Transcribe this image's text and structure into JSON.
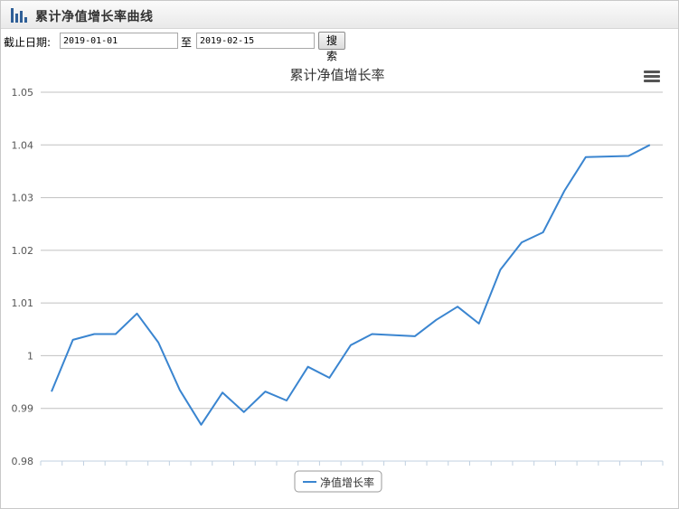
{
  "window": {
    "title": "累计净值增长率曲线"
  },
  "filter": {
    "label": "截止日期:",
    "start_date": "2019-01-01",
    "separator": "至",
    "end_date": "2019-02-15",
    "search_label": "搜索"
  },
  "chart_data": {
    "type": "line",
    "title": "累计净值增长率",
    "xlabel": "",
    "ylabel": "",
    "ylim": [
      0.98,
      1.05
    ],
    "yticks": [
      0.98,
      0.99,
      1,
      1.01,
      1.02,
      1.03,
      1.04,
      1.05
    ],
    "ytick_labels": [
      "0.98",
      "0.99",
      "1",
      "1.01",
      "1.02",
      "1.03",
      "1.04",
      "1.05"
    ],
    "grid": true,
    "legend": "bottom-center",
    "series": [
      {
        "name": "净值增长率",
        "color": "#3a85d0",
        "values": [
          0.9932,
          1.003,
          1.0041,
          1.0041,
          1.008,
          1.0025,
          0.9935,
          0.9869,
          0.993,
          0.9893,
          0.9932,
          0.9915,
          0.9979,
          0.9958,
          1.002,
          1.0041,
          1.0037,
          1.0068,
          1.0093,
          1.0061,
          1.0163,
          1.0215,
          1.0234,
          1.0313,
          1.0377,
          1.0379,
          1.04
        ]
      }
    ],
    "x_index": [
      0,
      1,
      2,
      3,
      4,
      5,
      6,
      7,
      8,
      9,
      10,
      11,
      12,
      13,
      14,
      15,
      17,
      18,
      19,
      20,
      21,
      22,
      23,
      24,
      25,
      27,
      28
    ]
  },
  "colors": {
    "accent": "#3a85d0",
    "title": "#333333",
    "grid": "#c0c0c0"
  }
}
